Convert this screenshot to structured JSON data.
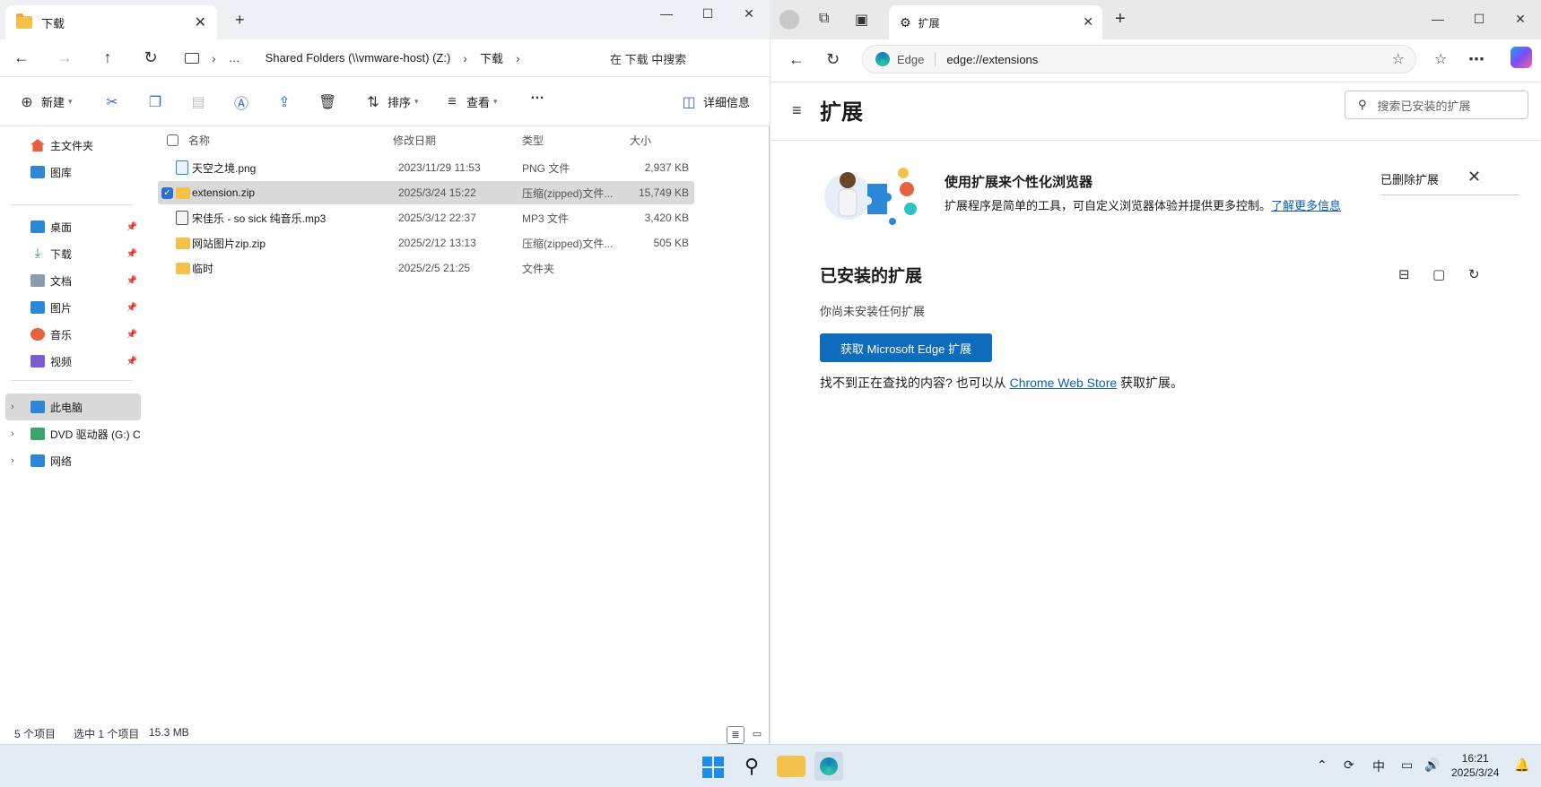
{
  "explorer": {
    "tab_title": "下载",
    "breadcrumb": [
      "…",
      "Shared Folders (\\\\vmware-host) (Z:)",
      "下载"
    ],
    "search_placeholder": "在 下载 中搜索",
    "toolbar": {
      "new": "新建",
      "sort": "排序",
      "view": "查看",
      "more": "…",
      "details": "详细信息"
    },
    "sidebar": {
      "home": "主文件夹",
      "gallery": "图库",
      "pinned": [
        {
          "label": "桌面",
          "icon": "desktop-icon",
          "color": "#2b88d8"
        },
        {
          "label": "下载",
          "icon": "download-icon",
          "color": "#1aa260"
        },
        {
          "label": "文档",
          "icon": "document-icon",
          "color": "#8e9aaf"
        },
        {
          "label": "图片",
          "icon": "picture-icon",
          "color": "#2b88d8"
        },
        {
          "label": "音乐",
          "icon": "music-icon",
          "color": "#e8613c"
        },
        {
          "label": "视频",
          "icon": "video-icon",
          "color": "#7b5cd6"
        }
      ],
      "this_pc": "此电脑",
      "dvd": "DVD 驱动器 (G:) C",
      "network": "网络"
    },
    "columns": {
      "name": "名称",
      "date": "修改日期",
      "type": "类型",
      "size": "大小"
    },
    "files": [
      {
        "name": "天空之境.png",
        "date": "2023/11/29 11:53",
        "type": "PNG 文件",
        "size": "2,937 KB",
        "icon": "image-file-icon",
        "selected": false
      },
      {
        "name": "extension.zip",
        "date": "2025/3/24 15:22",
        "type": "压缩(zipped)文件...",
        "size": "15,749 KB",
        "icon": "zip-file-icon",
        "selected": true
      },
      {
        "name": "宋佳乐 - so sick 纯音乐.mp3",
        "date": "2025/3/12 22:37",
        "type": "MP3 文件",
        "size": "3,420 KB",
        "icon": "audio-file-icon",
        "selected": false
      },
      {
        "name": "网站图片zip.zip",
        "date": "2025/2/12 13:13",
        "type": "压缩(zipped)文件...",
        "size": "505 KB",
        "icon": "zip-file-icon",
        "selected": false
      },
      {
        "name": "临时",
        "date": "2025/2/5 21:25",
        "type": "文件夹",
        "size": "",
        "icon": "folder-icon",
        "selected": false
      }
    ],
    "status": {
      "count": "5 个项目",
      "selection": "选中 1 个项目",
      "size": "15.3 MB"
    }
  },
  "edge": {
    "tab_title": "扩展",
    "url_label": "Edge",
    "url": "edge://extensions",
    "page_title": "扩展",
    "search_placeholder": "搜索已安装的扩展",
    "promo": {
      "title": "使用扩展来个性化浏览器",
      "desc": "扩展程序是简单的工具，可自定义浏览器体验并提供更多控制。",
      "link": "了解更多信息",
      "removed": "已删除扩展"
    },
    "installed": {
      "title": "已安装的扩展",
      "empty": "你尚未安装任何扩展",
      "button": "获取 Microsoft Edge 扩展",
      "footer_pre": "找不到正在查找的内容? 也可以从 ",
      "footer_link": "Chrome Web Store",
      "footer_post": " 获取扩展。"
    }
  },
  "taskbar": {
    "ime": "中",
    "time": "16:21",
    "date": "2025/3/24"
  }
}
